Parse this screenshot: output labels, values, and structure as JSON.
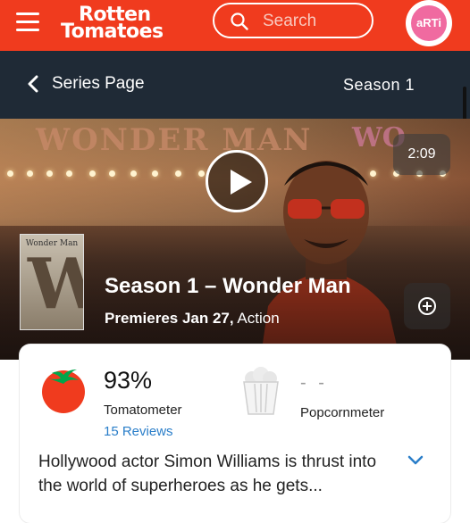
{
  "header": {
    "logo_line1": "Rotten",
    "logo_line2": "Tomatoes",
    "search_placeholder": "Search",
    "avatar_text": "aRTi",
    "brand_color": "#f03b1e"
  },
  "subnav": {
    "back_label": "Series Page",
    "season_label": "Season 1"
  },
  "hero": {
    "sign_text": "WONDER MAN",
    "sign_text_right": "WO",
    "duration": "2:09",
    "poster_title": "Wonder Man",
    "title": "Season 1 – Wonder Man",
    "premiere": "Premieres Jan 27,",
    "genre": "Action"
  },
  "scores": {
    "tomatometer_value": "93%",
    "tomatometer_label": "Tomatometer",
    "reviews": "15 Reviews",
    "popcornmeter_value": "- -",
    "popcornmeter_label": "Popcornmeter"
  },
  "synopsis": "Hollywood actor Simon Williams is thrust into the world of superheroes as he gets...",
  "icons": [
    "menu-icon",
    "search-icon",
    "chevron-left-icon",
    "play-icon",
    "plus-circle-icon",
    "tomato-icon",
    "popcorn-icon",
    "chevron-down-icon"
  ]
}
